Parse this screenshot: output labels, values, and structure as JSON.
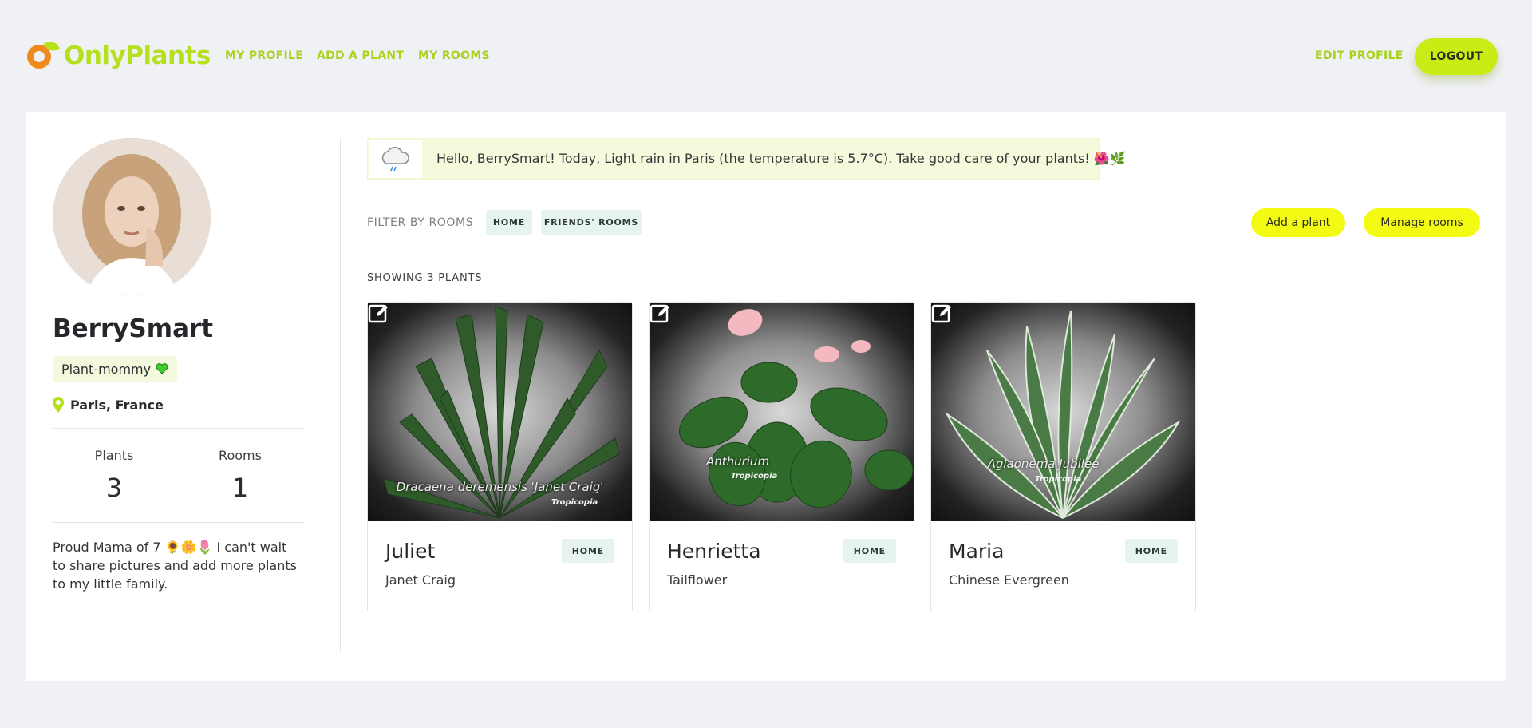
{
  "nav": {
    "brand": "OnlyPlants",
    "links": [
      "MY PROFILE",
      "ADD A PLANT",
      "MY ROOMS"
    ],
    "edit_profile": "EDIT PROFILE",
    "logout": "LOGOUT"
  },
  "profile": {
    "username": "BerrySmart",
    "role": "Plant-mommy",
    "location": "Paris, France",
    "stats": [
      {
        "label": "Plants",
        "value": "3"
      },
      {
        "label": "Rooms",
        "value": "1"
      }
    ],
    "bio": "Proud Mama of 7 🌻🌼🌷 I can't wait to share pictures and add more plants to my little family."
  },
  "weather": {
    "icon": "rain-cloud-icon",
    "message": "Hello, BerrySmart! Today, Light rain in Paris (the temperature is 5.7°C). Take good care of your plants! 🌺🌿"
  },
  "filters": {
    "label": "FILTER BY ROOMS",
    "chips": [
      "HOME",
      "FRIENDS' ROOMS"
    ],
    "add_plant": "Add a plant",
    "manage_rooms": "Manage rooms"
  },
  "showing": "SHOWING 3 PLANTS",
  "plants": [
    {
      "name": "Juliet",
      "room": "HOME",
      "species": "Janet Craig",
      "caption": "Dracaena deremensis 'Janet Craig'",
      "brand": "Tropicopia"
    },
    {
      "name": "Henrietta",
      "room": "HOME",
      "species": "Tailflower",
      "caption": "Anthurium",
      "brand": "Tropicopia"
    },
    {
      "name": "Maria",
      "room": "HOME",
      "species": "Chinese Evergreen",
      "caption": "Aglaonema Jubilee",
      "brand": "Tropicopia"
    }
  ],
  "colors": {
    "accent": "#b4e11c",
    "logout_bg": "#c9ec14",
    "pill_bg": "#f4fb12",
    "chip_bg": "#e7f3ee",
    "weather_bg": "#f4fbdc",
    "page_bg": "#f0f1f5"
  }
}
